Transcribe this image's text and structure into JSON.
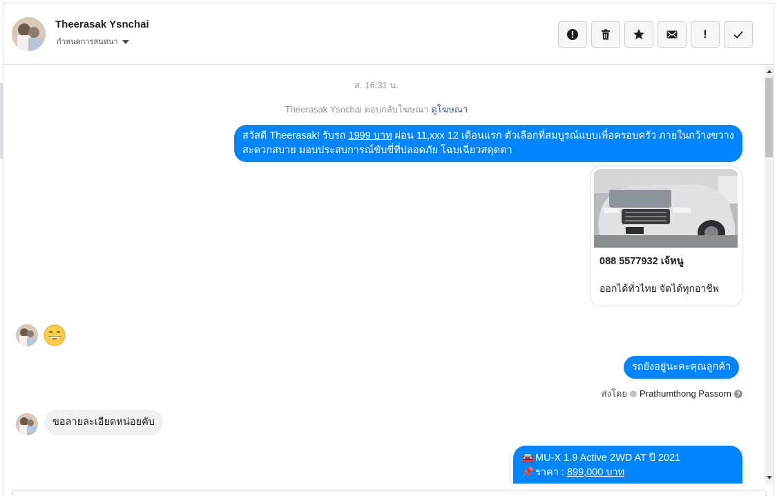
{
  "header": {
    "contact_name": "Theerasak Ysnchai",
    "conversation_settings": "กำหนดการสนทนา",
    "actions": [
      {
        "name": "report-button",
        "icon": "alert-circle-icon"
      },
      {
        "name": "delete-button",
        "icon": "trash-icon"
      },
      {
        "name": "star-button",
        "icon": "star-icon"
      },
      {
        "name": "mark-unread-button",
        "icon": "envelope-icon"
      },
      {
        "name": "important-button",
        "icon": "exclamation-icon",
        "glyph": "!"
      },
      {
        "name": "mark-done-button",
        "icon": "checkmark-icon"
      }
    ]
  },
  "thread": {
    "timestamp": "ส. 16:31 น.",
    "replied_note": {
      "text": "Theerasak Ysnchai ตอบกลับโฆษณา",
      "link": "ดูโฆษณา"
    },
    "messages": [
      {
        "direction": "out",
        "text_before": "สวัสดี Theerasak! รับรถ ",
        "link": "1999 บาท",
        "text_after": " ผ่อน 11,xxx 12 เดือนแรก ตัวเลือกที่สมบูรณ์แบบเพื่อครอบครัว ภายในกว้างขวาง สะดวกสบาย มอบประสบการณ์ขับขี่ที่ปลอดภัย โฉบเฉี่ยวสดุดตา"
      },
      {
        "direction": "out",
        "type": "card",
        "title": "088 5577932 เจ้หนู",
        "subtitle": "ออกได้ทั่วไทย จัดได้ทุกอาชีพ"
      },
      {
        "direction": "in",
        "type": "emoji",
        "emoji": "grinning-face-icon"
      },
      {
        "direction": "out",
        "text": "รถยังอยู่นะคะคุณลูกค้า"
      },
      {
        "direction": "in",
        "text": "ขอลายละเอียดหน่อยคับ"
      },
      {
        "direction": "out",
        "lines": [
          {
            "icon": "🚘",
            "text": "MU-X 1.9 Active 2WD AT ปี 2021"
          },
          {
            "icon": "📌",
            "text_before": "ราคา : ",
            "link": "899,000 บาท"
          }
        ]
      }
    ],
    "sent_by": {
      "label": "ส่งโดย",
      "name": "Prathumthong Passorn"
    }
  },
  "colors": {
    "outgoing_bubble": "#0084ff",
    "incoming_bubble": "#f1f0f0",
    "link": "#385898"
  }
}
